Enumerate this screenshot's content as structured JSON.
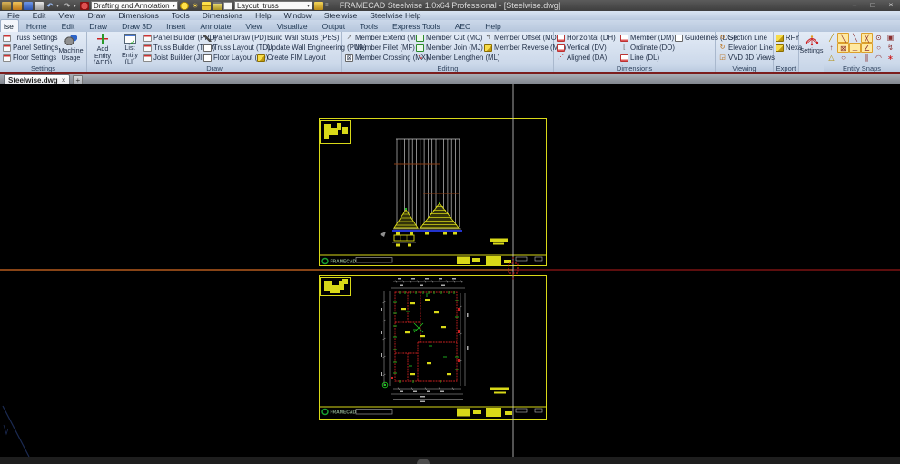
{
  "window": {
    "title": "FRAMECAD Steelwise 1.0x64 Professional  - [Steelwise.dwg]",
    "minimize": "–",
    "maximize": "□",
    "close": "×"
  },
  "quick_access": {
    "workspace": "Drafting and Annotation",
    "layout": "Layout_truss",
    "icons": {
      "undo": "↶",
      "redo": "↷",
      "sun": "☀",
      "caret": "▾",
      "pin": "≡"
    }
  },
  "menubar": {
    "items": [
      "File",
      "Edit",
      "View",
      "Draw",
      "Dimensions",
      "Tools",
      "Dimensions",
      "Help",
      "Window",
      "Steelwise",
      "Steelwise Help"
    ]
  },
  "ribbon_tabs": {
    "active_partial": "ise",
    "items": [
      "Home",
      "Edit",
      "Draw",
      "Draw 3D",
      "Insert",
      "Annotate",
      "View",
      "Visualize",
      "Output",
      "Tools",
      "Express Tools",
      "AEC",
      "Help"
    ]
  },
  "ribbon": {
    "settings": {
      "label": "Settings",
      "truss": "Truss Settings",
      "panel": "Panel Settings",
      "floor": "Floor Settings",
      "machine_usage": "Machine Usage"
    },
    "draw": {
      "label": "Draw",
      "add_entity": "Add Entity (ADD)",
      "list_entity": "List Entity (LI)",
      "panel_builder": "Panel Builder (PPD)",
      "truss_builder": "Truss Builder (TTD)",
      "joist_builder": "Joist Builder (JID)",
      "panel_draw": "Panel Draw (PD)",
      "truss_layout": "Truss Layout (TD)",
      "floor_layout": "Floor Layout (JD)",
      "build_wall_studs": "Build Wall Studs (PBS)",
      "update_wall_engineering": "Update Wall Engineering (PUA)",
      "create_fim_layout": "Create FIM Layout"
    },
    "editing": {
      "label": "Editing",
      "member_extend": "Member Extend (ME)",
      "member_fillet": "Member Fillet (MF)",
      "member_crossing": "Member Crossing (MX)",
      "member_cut": "Member Cut (MC)",
      "member_join": "Member Join (MJ)",
      "member_lengthen": "Member Lengthen (ML)",
      "member_offset": "Member Offset (MO)",
      "member_reverse": "Member Reverse (MR)"
    },
    "dimensions": {
      "label": "Dimensions",
      "horizontal": "Horizontal (DH)",
      "vertical": "Vertical (DV)",
      "aligned": "Aligned (DA)",
      "member": "Member (DM)",
      "ordinate": "Ordinate (DO)",
      "line": "Line (DL)",
      "guidelines": "Guidelines (DG)"
    },
    "viewing": {
      "label": "Viewing",
      "section_line": "Section Line",
      "elevation_line": "Elevation Line",
      "vvd_3d_views": "VVD 3D Views"
    },
    "export": {
      "label": "Export",
      "rfy": "RFY",
      "nexa": "Nexa"
    },
    "snaps": {
      "label": "Entity Snaps",
      "settings": "Settings",
      "glyphs": [
        "╱",
        "╲",
        "╲",
        "╳",
        "⊙",
        "▣",
        "↑",
        "⊠",
        "⊥",
        "∠",
        "○",
        "↯",
        "△",
        "○",
        "•",
        "∥",
        "◠",
        "∗"
      ]
    }
  },
  "doc_tabs": {
    "active": "Steelwise.dwg",
    "close": "×",
    "new_tab": "+"
  },
  "canvas": {
    "brand": "FRAMECAD"
  },
  "colors": {
    "sheet_border": "#d9d918",
    "crosshair": "#cfcfcf",
    "rubber_line_left": "#b55a1e",
    "rubber_line_right": "#7c1212",
    "plan_wall": "#cc2222",
    "plan_marks": "#22cc22"
  }
}
